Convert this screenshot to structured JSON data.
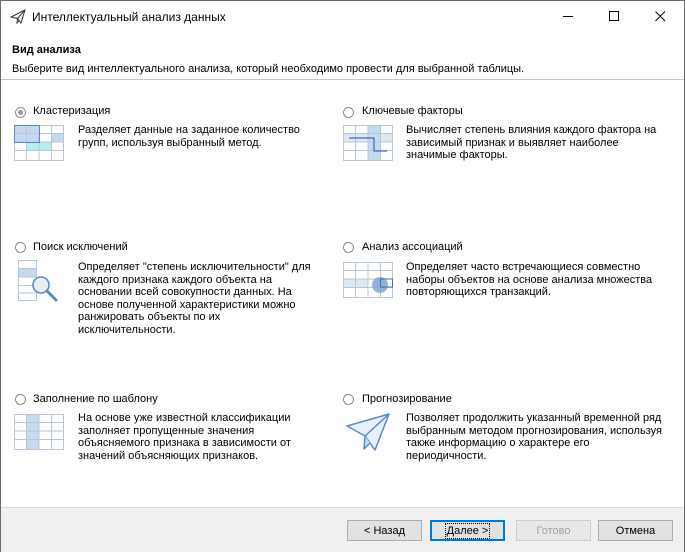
{
  "window": {
    "title": "Интеллектуальный анализ данных"
  },
  "header": {
    "title": "Вид анализа",
    "subtitle": "Выберите вид интеллектуального анализа, который необходимо провести для выбранной таблицы."
  },
  "options": [
    {
      "label": "Кластеризация",
      "selected": true,
      "icon": "clustering-grid-icon",
      "description": "Разделяет данные на заданное количество групп, используя выбранный метод."
    },
    {
      "label": "Ключевые факторы",
      "selected": false,
      "icon": "key-factors-grid-icon",
      "description": "Вычисляет степень влияния каждого фактора на зависимый признак и выявляет наиболее значимые факторы."
    },
    {
      "label": "Поиск исключений",
      "selected": false,
      "icon": "magnifier-grid-icon",
      "description": "Определяет \"степень исключительности\" для каждого признака каждого объекта на основании всей совокупности данных. На основе полученной характеристики можно ранжировать объекты по их исключительности."
    },
    {
      "label": "Анализ ассоциаций",
      "selected": false,
      "icon": "association-grid-icon",
      "description": "Определяет часто встречающиеся совместно наборы объектов на основе анализа множества повторяющихся транзакций."
    },
    {
      "label": "Заполнение по шаблону",
      "selected": false,
      "icon": "fill-template-grid-icon",
      "description": "На основе уже известной классификации заполняет пропущенные значения объясняемого признака в зависимости от значений объясняющих признаков."
    },
    {
      "label": "Прогнозирование",
      "selected": false,
      "icon": "paper-plane-icon",
      "description": "Позволяет продолжить указанный временной ряд выбранным методом прогнозирования, используя также информацию о характере его периодичности."
    }
  ],
  "buttons": {
    "back": "< Назад",
    "next": "Далее >",
    "finish": "Готово",
    "cancel": "Отмена"
  },
  "colors": {
    "accent": "#0078d7",
    "grid_blue": "#c5d9f1",
    "grid_cyan": "#b7ecf3",
    "grid_border": "#8ea9d8"
  }
}
